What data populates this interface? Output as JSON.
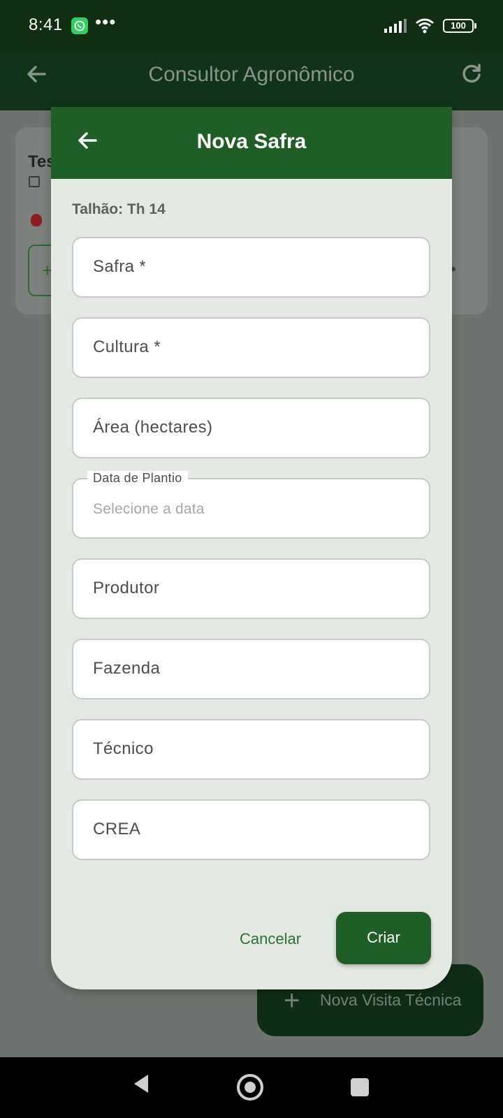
{
  "status_bar": {
    "time": "8:41",
    "notification_icon": "whatsapp-icon",
    "overflow": "•••",
    "battery": "100"
  },
  "app_bar": {
    "title": "Consultor Agronômico",
    "back_icon": "arrow-left-icon",
    "refresh_icon": "refresh-icon"
  },
  "background": {
    "card_title_partial": "Tes",
    "fab_label": "Nova Visita Técnica",
    "fab_icon": "plus-icon"
  },
  "dialog": {
    "title": "Nova Safra",
    "subtitle": "Talhão: Th 14",
    "fields": [
      {
        "label": "Safra *"
      },
      {
        "label": "Cultura *"
      },
      {
        "label": "Área (hectares)"
      },
      {
        "label": "Data de Plantio",
        "placeholder": "Selecione a data"
      },
      {
        "label": "Produtor"
      },
      {
        "label": "Fazenda"
      },
      {
        "label": "Técnico"
      },
      {
        "label": "CREA"
      }
    ],
    "cancel_label": "Cancelar",
    "create_label": "Criar"
  },
  "colors": {
    "primary": "#1f5e24",
    "status_bar": "#0f2e12",
    "dialog_background": "#e4e9e3",
    "accent_text": "#2a7230"
  }
}
